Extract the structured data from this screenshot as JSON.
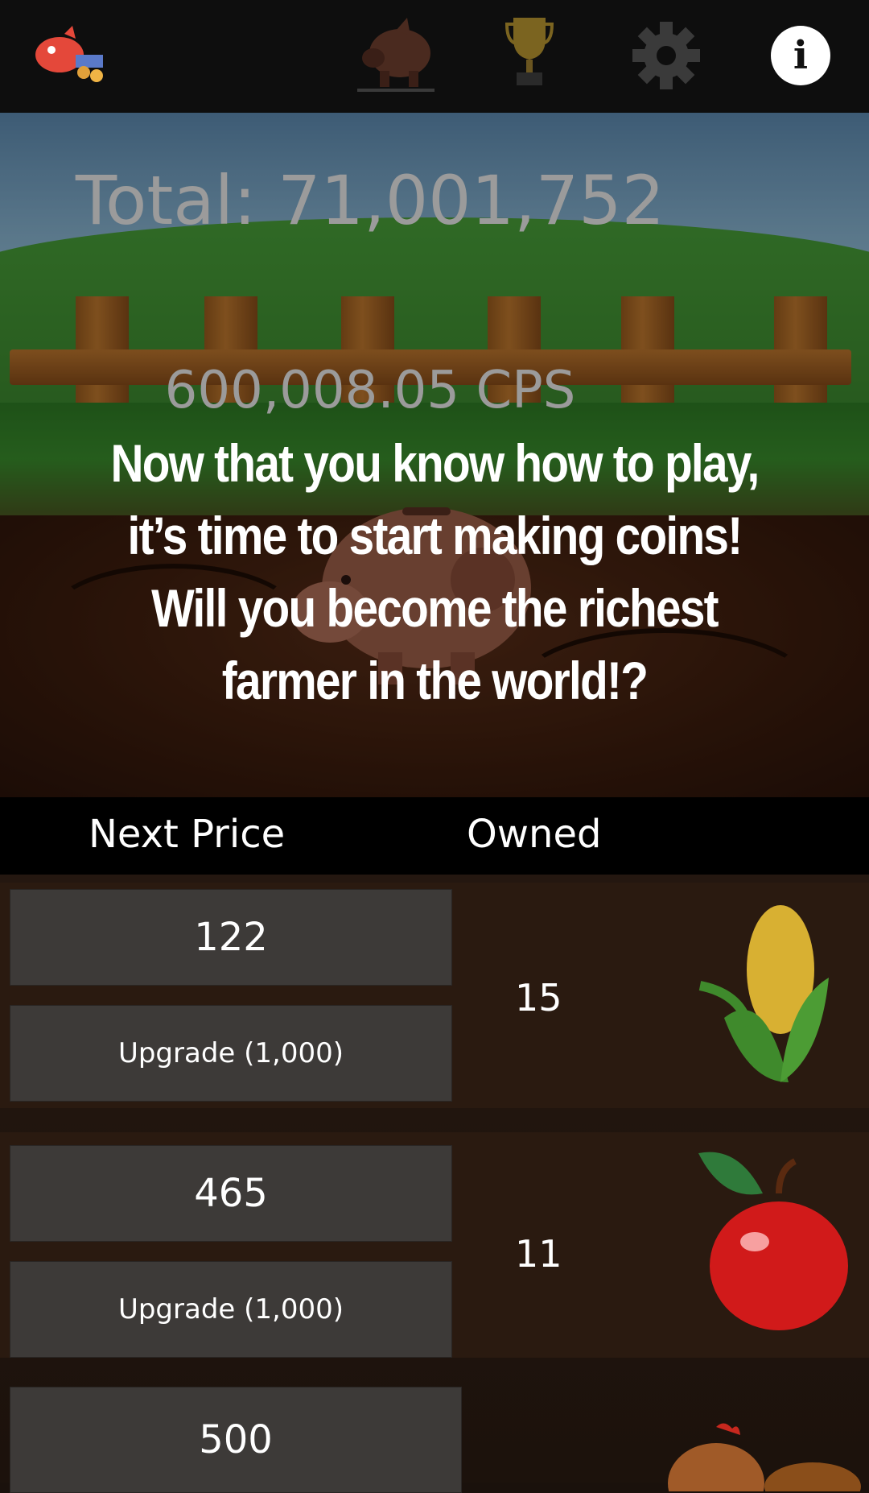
{
  "header": {
    "tabs": [
      {
        "icon": "piggy-bank-icon"
      },
      {
        "icon": "trophy-icon"
      },
      {
        "icon": "gear-icon"
      },
      {
        "icon": "info-icon",
        "label": "i"
      }
    ]
  },
  "stats": {
    "total": "Total: 71,001,752",
    "cps": "600,008.05 CPS"
  },
  "tutorial": {
    "lines": [
      "Now that you know how to play,",
      "it’s time to start making coins!",
      "Will you become the richest",
      "farmer in the world!?"
    ]
  },
  "columns": {
    "price": "Next Price",
    "owned": "Owned"
  },
  "items": [
    {
      "name": "corn",
      "price": "122",
      "upgrade": "Upgrade (1,000)",
      "owned": "15",
      "icon": "corn-icon"
    },
    {
      "name": "apple",
      "price": "465",
      "upgrade": "Upgrade (1,000)",
      "owned": "11",
      "icon": "apple-icon"
    },
    {
      "name": "chicken",
      "price": "500",
      "icon": "chicken-icon"
    }
  ]
}
